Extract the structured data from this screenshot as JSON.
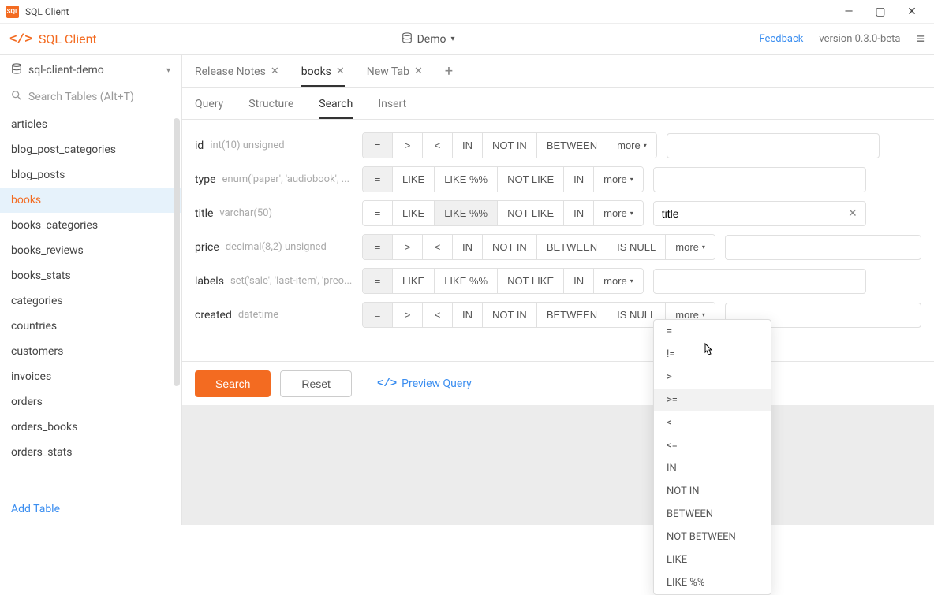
{
  "window": {
    "title": "SQL Client"
  },
  "toolbar": {
    "brand": "SQL Client",
    "database_label": "Demo",
    "feedback": "Feedback",
    "version": "version 0.3.0-beta"
  },
  "sidebar": {
    "database_name": "sql-client-demo",
    "search_placeholder": "Search Tables (Alt+T)",
    "tables": [
      "articles",
      "blog_post_categories",
      "blog_posts",
      "books",
      "books_categories",
      "books_reviews",
      "books_stats",
      "categories",
      "countries",
      "customers",
      "invoices",
      "orders",
      "orders_books",
      "orders_stats"
    ],
    "active_table": "books",
    "add_table": "Add Table"
  },
  "tabs": {
    "items": [
      {
        "label": "Release Notes",
        "closable": true,
        "active": false
      },
      {
        "label": "books",
        "closable": true,
        "active": true
      },
      {
        "label": "New Tab",
        "closable": true,
        "active": false
      }
    ]
  },
  "subtabs": {
    "items": [
      "Query",
      "Structure",
      "Search",
      "Insert"
    ],
    "active": "Search"
  },
  "search": {
    "columns": [
      {
        "name": "id",
        "type": "int(10) unsigned",
        "ops": [
          "=",
          ">",
          "<",
          "IN",
          "NOT IN",
          "BETWEEN"
        ],
        "active_op": "=",
        "more": "more",
        "value": ""
      },
      {
        "name": "type",
        "type": "enum('paper', 'audiobook', ...",
        "ops": [
          "=",
          "LIKE",
          "LIKE %%",
          "NOT LIKE",
          "IN"
        ],
        "active_op": "=",
        "more": "more",
        "value": ""
      },
      {
        "name": "title",
        "type": "varchar(50)",
        "ops": [
          "=",
          "LIKE",
          "LIKE %%",
          "NOT LIKE",
          "IN"
        ],
        "active_op": "LIKE %%",
        "more": "more",
        "value": "title"
      },
      {
        "name": "price",
        "type": "decimal(8,2) unsigned",
        "ops": [
          "=",
          ">",
          "<",
          "IN",
          "NOT IN",
          "BETWEEN",
          "IS NULL"
        ],
        "active_op": "=",
        "more": "more",
        "value": ""
      },
      {
        "name": "labels",
        "type": "set('sale', 'last-item', 'preo...",
        "ops": [
          "=",
          "LIKE",
          "LIKE %%",
          "NOT LIKE",
          "IN"
        ],
        "active_op": "=",
        "more": "more",
        "value": ""
      },
      {
        "name": "created",
        "type": "datetime",
        "ops": [
          "=",
          ">",
          "<",
          "IN",
          "NOT IN",
          "BETWEEN",
          "IS NULL"
        ],
        "active_op": "=",
        "more": "more",
        "value": ""
      }
    ],
    "search_button": "Search",
    "reset_button": "Reset",
    "preview_button": "Preview Query"
  },
  "dropdown": {
    "items": [
      "=",
      "!=",
      ">",
      ">=",
      "<",
      "<=",
      "IN",
      "NOT IN",
      "BETWEEN",
      "NOT BETWEEN",
      "LIKE",
      "LIKE %%"
    ],
    "hovered": ">="
  }
}
